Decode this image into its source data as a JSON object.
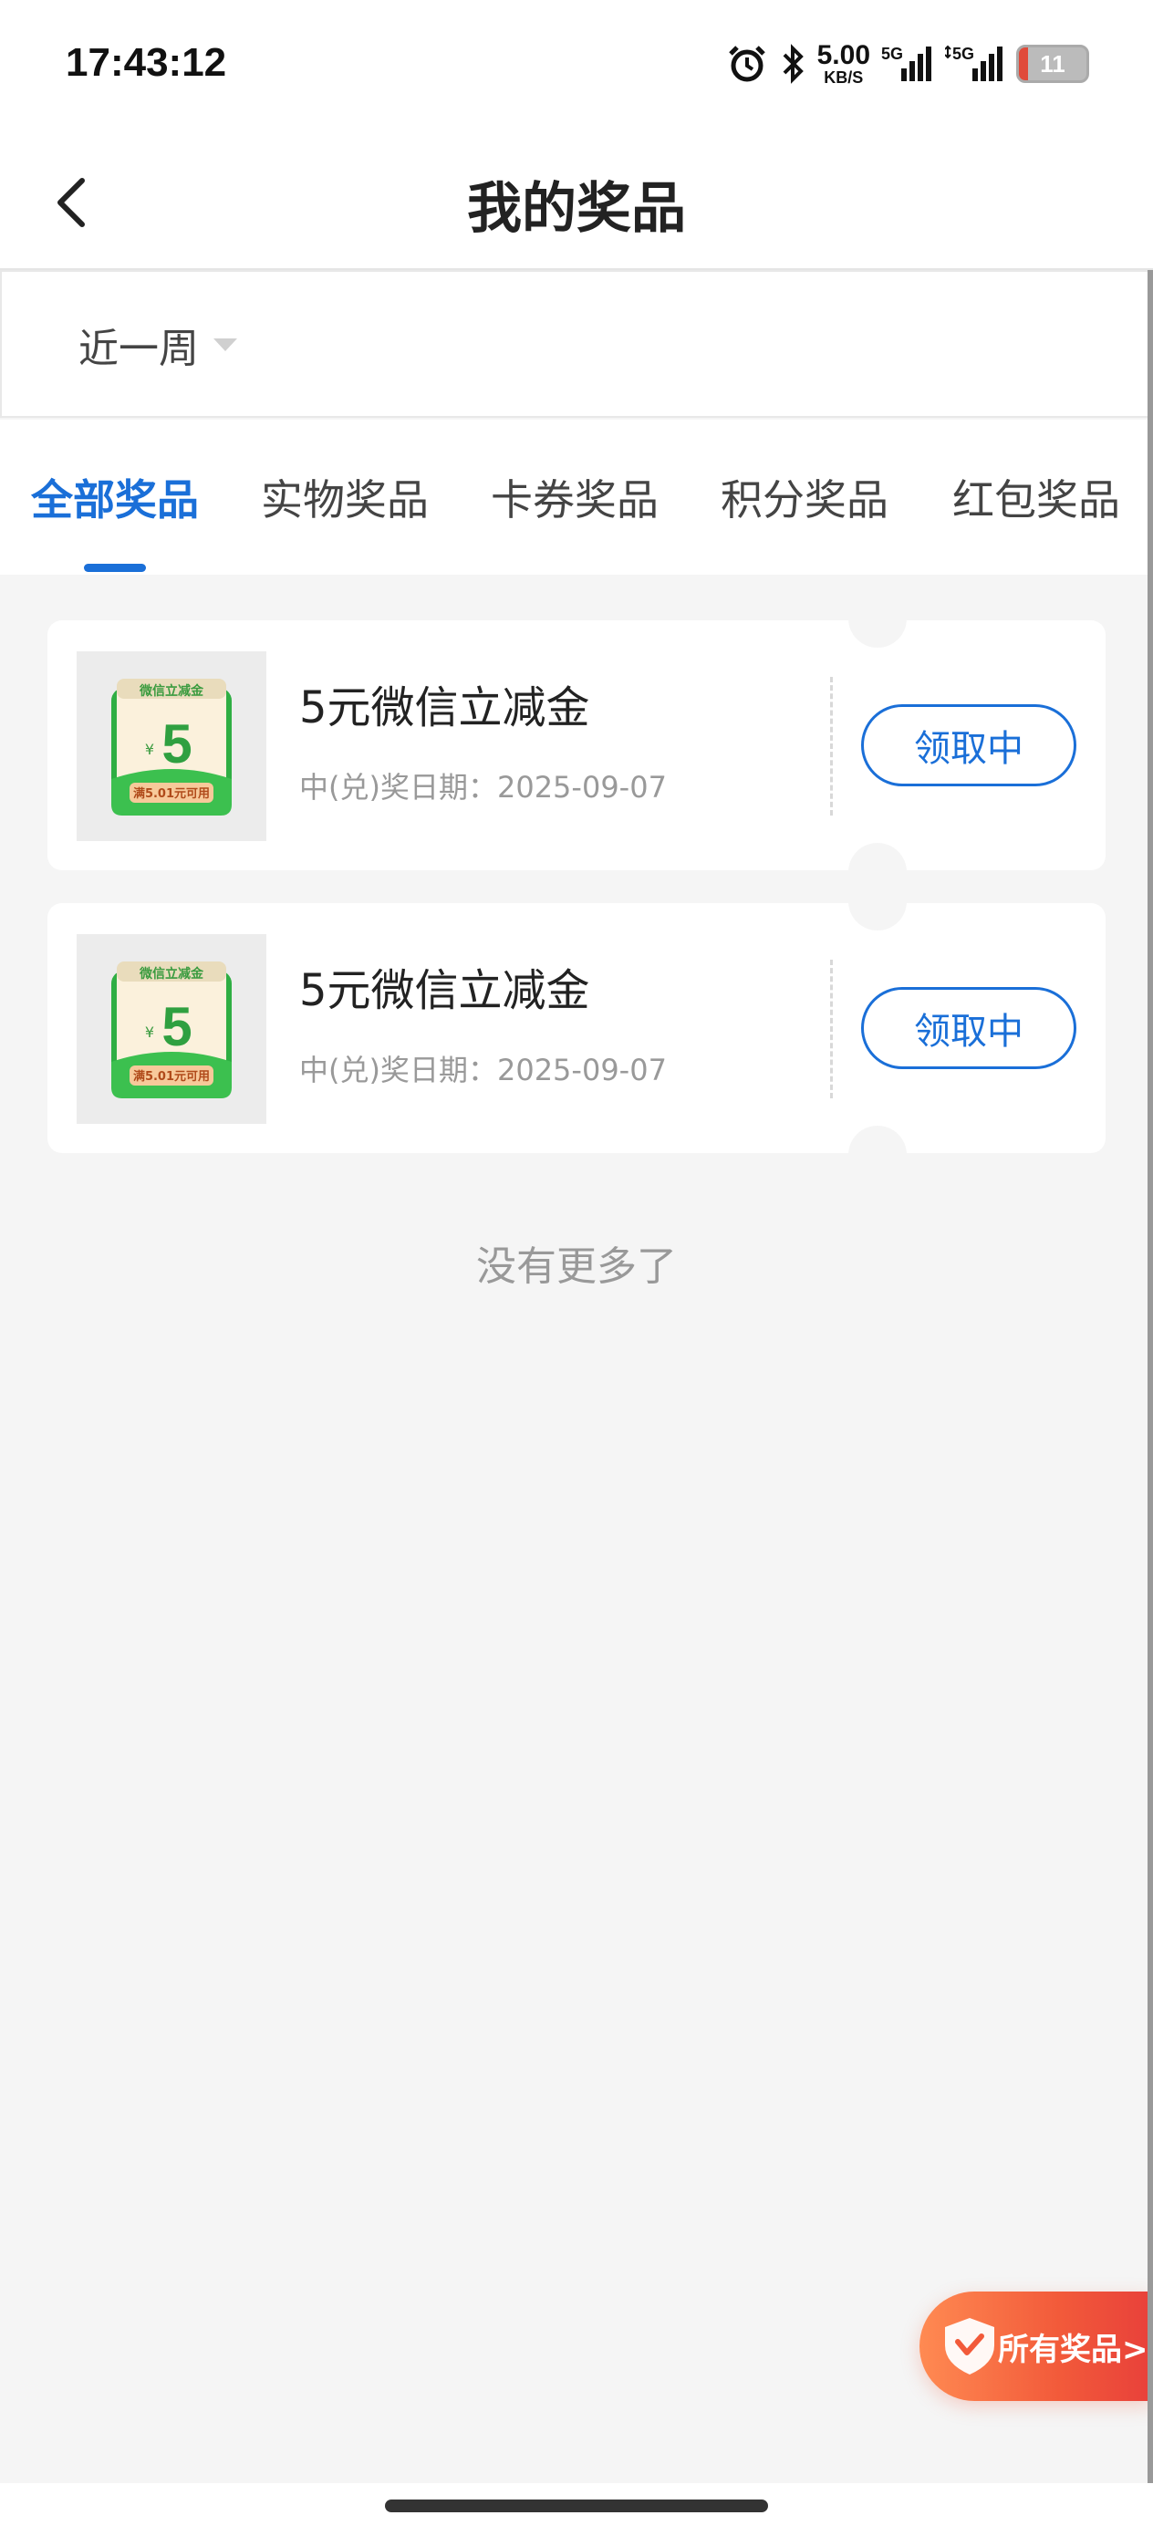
{
  "status_bar": {
    "time": "17:43:12",
    "net_speed_value": "5.00",
    "net_speed_unit": "KB/S",
    "sim1": "5G",
    "sim2": "5G",
    "battery": "11",
    "icons": [
      "alarm-icon",
      "bluetooth-icon",
      "signal-icon",
      "signal-icon"
    ]
  },
  "header": {
    "title": "我的奖品",
    "back_icon": "chevron-left-icon"
  },
  "filter": {
    "selected": "近一周",
    "icon": "caret-down-icon"
  },
  "tabs": [
    {
      "label": "全部奖品",
      "active": true
    },
    {
      "label": "实物奖品",
      "active": false
    },
    {
      "label": "卡券奖品",
      "active": false
    },
    {
      "label": "积分奖品",
      "active": false
    },
    {
      "label": "红包奖品",
      "active": false
    }
  ],
  "prizes": [
    {
      "name": "5元微信立减金",
      "date": "中(兑)奖日期：2025-09-07",
      "button": "领取中",
      "thumb": {
        "top_text": "微信立减金",
        "currency": "¥",
        "amount": "5",
        "condition": "满5.01元可用"
      }
    },
    {
      "name": "5元微信立减金",
      "date": "中(兑)奖日期：2025-09-07",
      "button": "领取中",
      "thumb": {
        "top_text": "微信立减金",
        "currency": "¥",
        "amount": "5",
        "condition": "满5.01元可用"
      }
    }
  ],
  "footer_text": "没有更多了",
  "float_button": {
    "label": "所有奖品>"
  },
  "colors": {
    "accent": "#1a6fd8",
    "float_gradient_start": "#ff8a52",
    "float_gradient_end": "#e8403a",
    "coupon_green": "#3cb64a"
  }
}
